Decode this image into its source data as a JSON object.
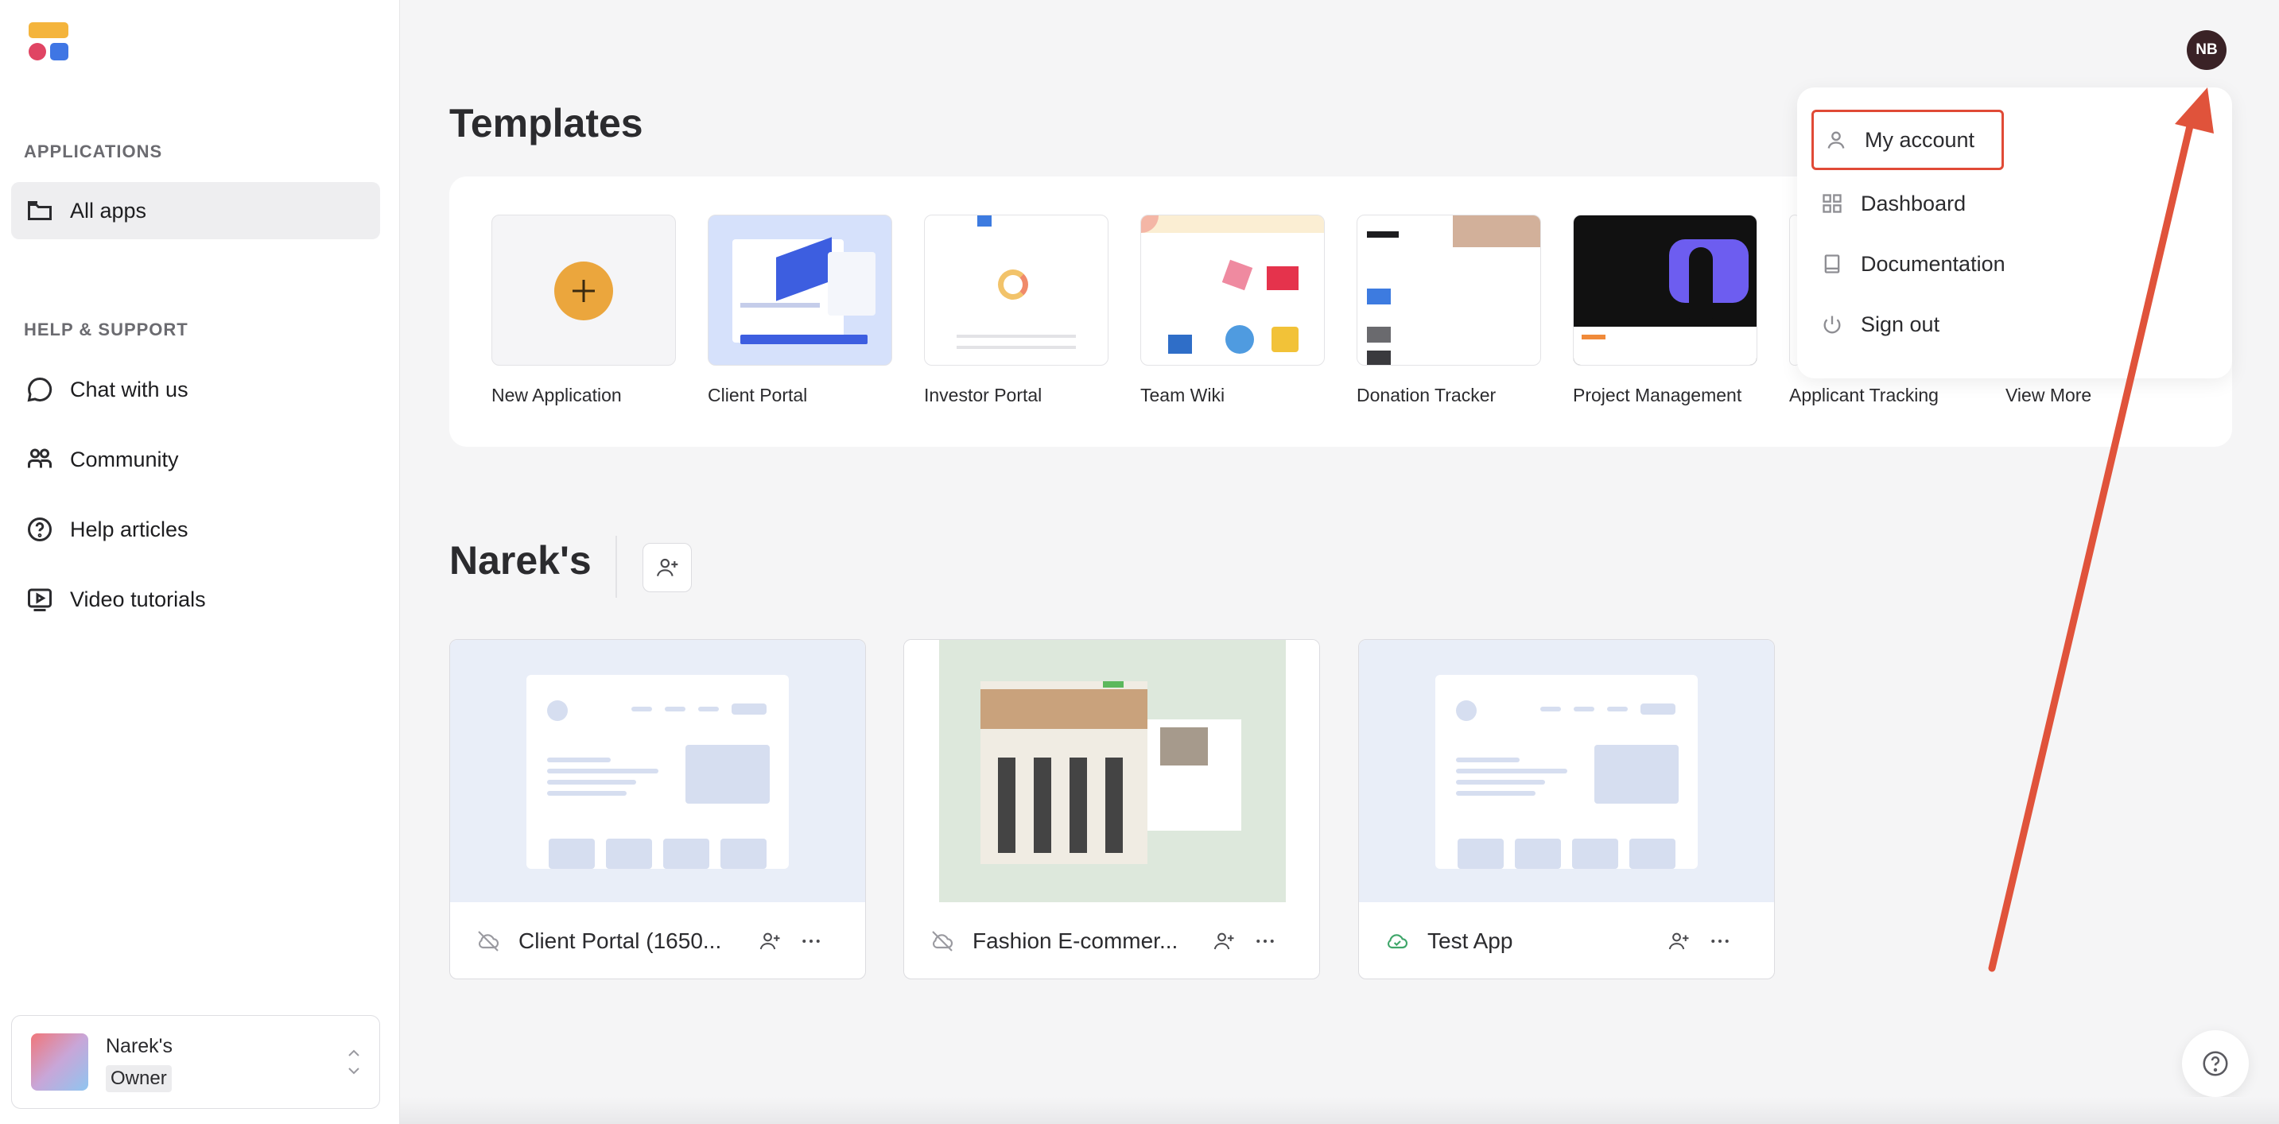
{
  "sidebar": {
    "applications_title": "APPLICATIONS",
    "all_apps": "All apps",
    "help_title": "HELP & SUPPORT",
    "help_items": [
      {
        "label": "Chat with us",
        "icon": "chat-icon"
      },
      {
        "label": "Community",
        "icon": "community-icon"
      },
      {
        "label": "Help articles",
        "icon": "help-circle-icon"
      },
      {
        "label": "Video tutorials",
        "icon": "video-icon"
      }
    ],
    "account": {
      "name": "Narek's",
      "role": "Owner"
    }
  },
  "header": {
    "avatar_initials": "NB"
  },
  "templates": {
    "title": "Templates",
    "items": [
      {
        "label": "New Application"
      },
      {
        "label": "Client Portal"
      },
      {
        "label": "Investor Portal"
      },
      {
        "label": "Team Wiki"
      },
      {
        "label": "Donation Tracker"
      },
      {
        "label": "Project Management"
      },
      {
        "label": "Applicant Tracking"
      },
      {
        "label": "View More"
      }
    ]
  },
  "menu": {
    "items": [
      {
        "label": "My account",
        "icon": "user-icon"
      },
      {
        "label": "Dashboard",
        "icon": "grid-icon"
      },
      {
        "label": "Documentation",
        "icon": "book-icon"
      },
      {
        "label": "Sign out",
        "icon": "power-icon"
      }
    ]
  },
  "workspace": {
    "title": "Narek's",
    "apps": [
      {
        "title": "Client Portal (1650...",
        "status": "unpublished"
      },
      {
        "title": "Fashion E-commer...",
        "status": "unpublished"
      },
      {
        "title": "Test App",
        "status": "published"
      }
    ]
  },
  "colors": {
    "accent": "#eba63d",
    "highlight": "#e04a36",
    "arrow": "#e0533b"
  }
}
